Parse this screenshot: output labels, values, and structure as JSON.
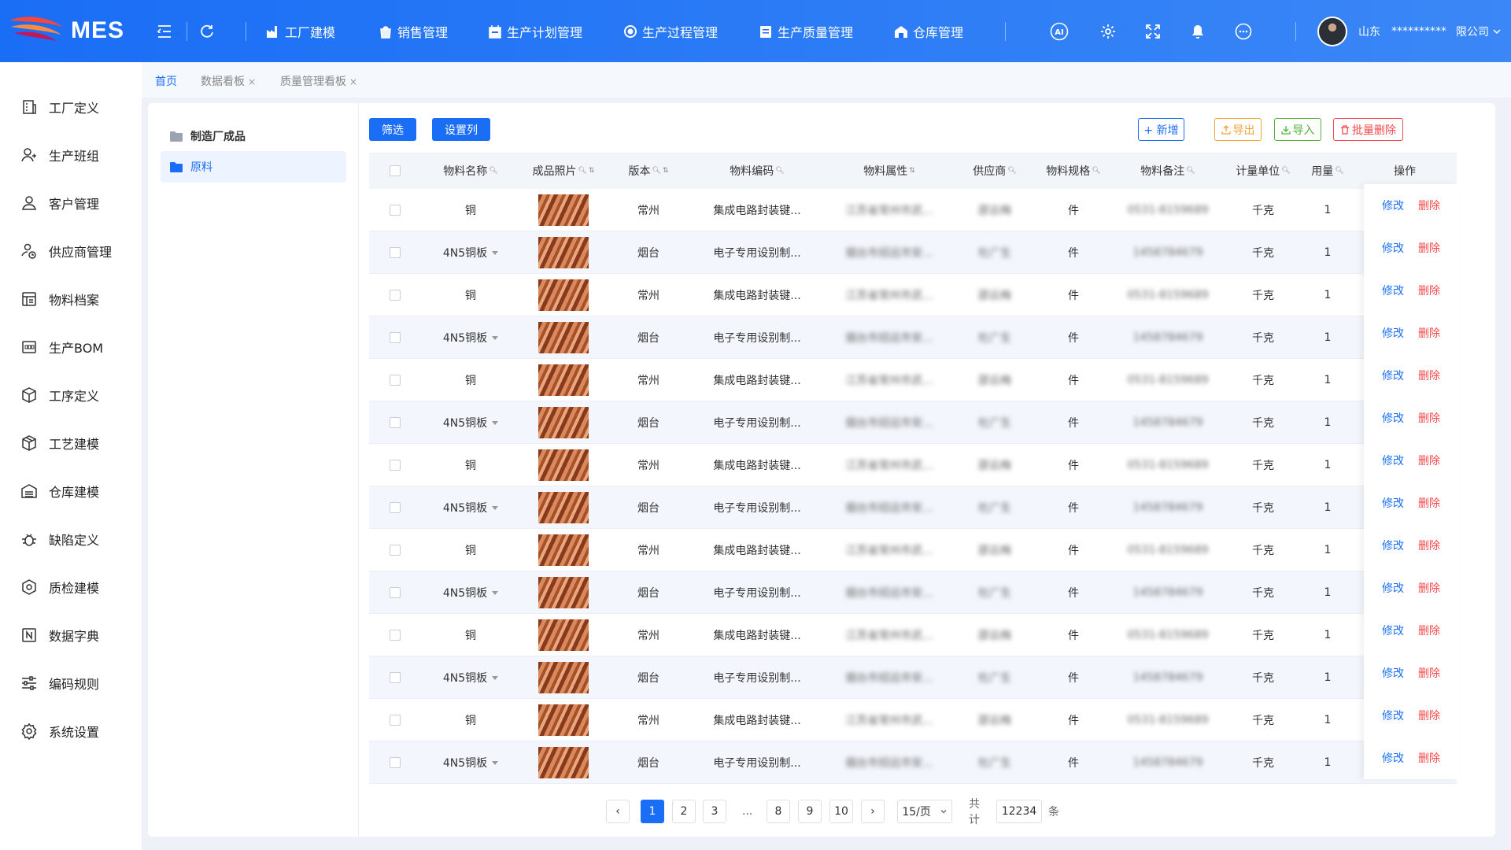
{
  "app": {
    "logo_text": "MES",
    "nav": [
      {
        "label": "工厂建模",
        "icon": "factory-icon"
      },
      {
        "label": "销售管理",
        "icon": "sales-bag-icon"
      },
      {
        "label": "生产计划管理",
        "icon": "calendar-icon"
      },
      {
        "label": "生产过程管理",
        "icon": "process-icon"
      },
      {
        "label": "生产质量管理",
        "icon": "quality-icon"
      },
      {
        "label": "仓库管理",
        "icon": "warehouse-icon"
      }
    ],
    "user": {
      "location": "山东",
      "company_masked": "**********",
      "company_suffix": "限公司"
    }
  },
  "sidebar": {
    "items": [
      {
        "label": "工厂定义",
        "icon": "building-icon"
      },
      {
        "label": "生产班组",
        "icon": "team-icon"
      },
      {
        "label": "客户管理",
        "icon": "customer-icon"
      },
      {
        "label": "供应商管理",
        "icon": "supplier-icon"
      },
      {
        "label": "物料档案",
        "icon": "material-file-icon"
      },
      {
        "label": "生产BOM",
        "icon": "bom-icon"
      },
      {
        "label": "工序定义",
        "icon": "cube-icon"
      },
      {
        "label": "工艺建模",
        "icon": "box-icon"
      },
      {
        "label": "仓库建模",
        "icon": "storage-icon"
      },
      {
        "label": "缺陷定义",
        "icon": "bug-icon"
      },
      {
        "label": "质检建模",
        "icon": "hexagon-icon"
      },
      {
        "label": "数据字典",
        "icon": "dictionary-icon"
      },
      {
        "label": "编码规则",
        "icon": "sliders-icon"
      },
      {
        "label": "系统设置",
        "icon": "gear-icon"
      }
    ]
  },
  "tabs": [
    {
      "label": "首页",
      "active": true,
      "closable": false
    },
    {
      "label": "数据看板",
      "active": false,
      "closable": true
    },
    {
      "label": "质量管理看板",
      "active": false,
      "closable": true
    }
  ],
  "tab_close_glyph": "×",
  "tree": [
    {
      "label": "制造厂成品",
      "selected": false
    },
    {
      "label": "原料",
      "selected": true
    }
  ],
  "toolbar": {
    "filter": "筛选",
    "set_columns": "设置列",
    "add": "+ 新增",
    "export": "导出",
    "import": "导入",
    "batch_delete": "批量删除"
  },
  "columns": [
    "物料名称",
    "成品照片",
    "版本",
    "物料编码",
    "物料属性",
    "供应商",
    "物料规格",
    "物料备注",
    "计量单位",
    "用量",
    "操作"
  ],
  "rows": [
    {
      "name": "铜",
      "version": "常州",
      "code": "集成电路封装键...",
      "attr": "江苏省常州市武...",
      "supplier": "邵云梅",
      "spec": "件",
      "remark": "0531-8159689",
      "unit": "千克",
      "qty": "1"
    },
    {
      "name": "4N5铜板",
      "version": "烟台",
      "code": "电子专用设别制...",
      "attr": "烟台市招远市安...",
      "supplier": "杜广生",
      "spec": "件",
      "remark": "1458784679",
      "unit": "千克",
      "qty": "1"
    },
    {
      "name": "铜",
      "version": "常州",
      "code": "集成电路封装键...",
      "attr": "江苏省常州市武...",
      "supplier": "邵云梅",
      "spec": "件",
      "remark": "0531-8159689",
      "unit": "千克",
      "qty": "1"
    },
    {
      "name": "4N5铜板",
      "version": "烟台",
      "code": "电子专用设别制...",
      "attr": "烟台市招远市安...",
      "supplier": "杜广生",
      "spec": "件",
      "remark": "1458784679",
      "unit": "千克",
      "qty": "1"
    },
    {
      "name": "铜",
      "version": "常州",
      "code": "集成电路封装键...",
      "attr": "江苏省常州市武...",
      "supplier": "邵云梅",
      "spec": "件",
      "remark": "0531-8159689",
      "unit": "千克",
      "qty": "1"
    },
    {
      "name": "4N5铜板",
      "version": "烟台",
      "code": "电子专用设别制...",
      "attr": "烟台市招远市安...",
      "supplier": "杜广生",
      "spec": "件",
      "remark": "1458784679",
      "unit": "千克",
      "qty": "1"
    },
    {
      "name": "铜",
      "version": "常州",
      "code": "集成电路封装键...",
      "attr": "江苏省常州市武...",
      "supplier": "邵云梅",
      "spec": "件",
      "remark": "0531-8159689",
      "unit": "千克",
      "qty": "1"
    },
    {
      "name": "4N5铜板",
      "version": "烟台",
      "code": "电子专用设别制...",
      "attr": "烟台市招远市安...",
      "supplier": "杜广生",
      "spec": "件",
      "remark": "1458784679",
      "unit": "千克",
      "qty": "1"
    },
    {
      "name": "铜",
      "version": "常州",
      "code": "集成电路封装键...",
      "attr": "江苏省常州市武...",
      "supplier": "邵云梅",
      "spec": "件",
      "remark": "0531-8159689",
      "unit": "千克",
      "qty": "1"
    },
    {
      "name": "4N5铜板",
      "version": "烟台",
      "code": "电子专用设别制...",
      "attr": "烟台市招远市安...",
      "supplier": "杜广生",
      "spec": "件",
      "remark": "1458784679",
      "unit": "千克",
      "qty": "1"
    },
    {
      "name": "铜",
      "version": "常州",
      "code": "集成电路封装键...",
      "attr": "江苏省常州市武...",
      "supplier": "邵云梅",
      "spec": "件",
      "remark": "0531-8159689",
      "unit": "千克",
      "qty": "1"
    },
    {
      "name": "4N5铜板",
      "version": "烟台",
      "code": "电子专用设别制...",
      "attr": "烟台市招远市安...",
      "supplier": "杜广生",
      "spec": "件",
      "remark": "1458784679",
      "unit": "千克",
      "qty": "1"
    },
    {
      "name": "铜",
      "version": "常州",
      "code": "集成电路封装键...",
      "attr": "江苏省常州市武...",
      "supplier": "邵云梅",
      "spec": "件",
      "remark": "0531-8159689",
      "unit": "千克",
      "qty": "1"
    },
    {
      "name": "4N5铜板",
      "version": "烟台",
      "code": "电子专用设别制...",
      "attr": "烟台市招远市安...",
      "supplier": "杜广生",
      "spec": "件",
      "remark": "1458784679",
      "unit": "千克",
      "qty": "1"
    }
  ],
  "row_actions": {
    "edit": "修改",
    "delete": "删除"
  },
  "pagination": {
    "prev": "‹",
    "next": "›",
    "pages": [
      "1",
      "2",
      "3",
      "8",
      "9",
      "10"
    ],
    "ellipsis": "...",
    "current": "1",
    "page_size": "15/页",
    "total_prefix": "共计",
    "total": "12234",
    "total_suffix": "条"
  },
  "colors": {
    "primary": "#1a6ef5",
    "danger": "#f5474b",
    "warning": "#f2a33a",
    "success": "#52b33a"
  }
}
